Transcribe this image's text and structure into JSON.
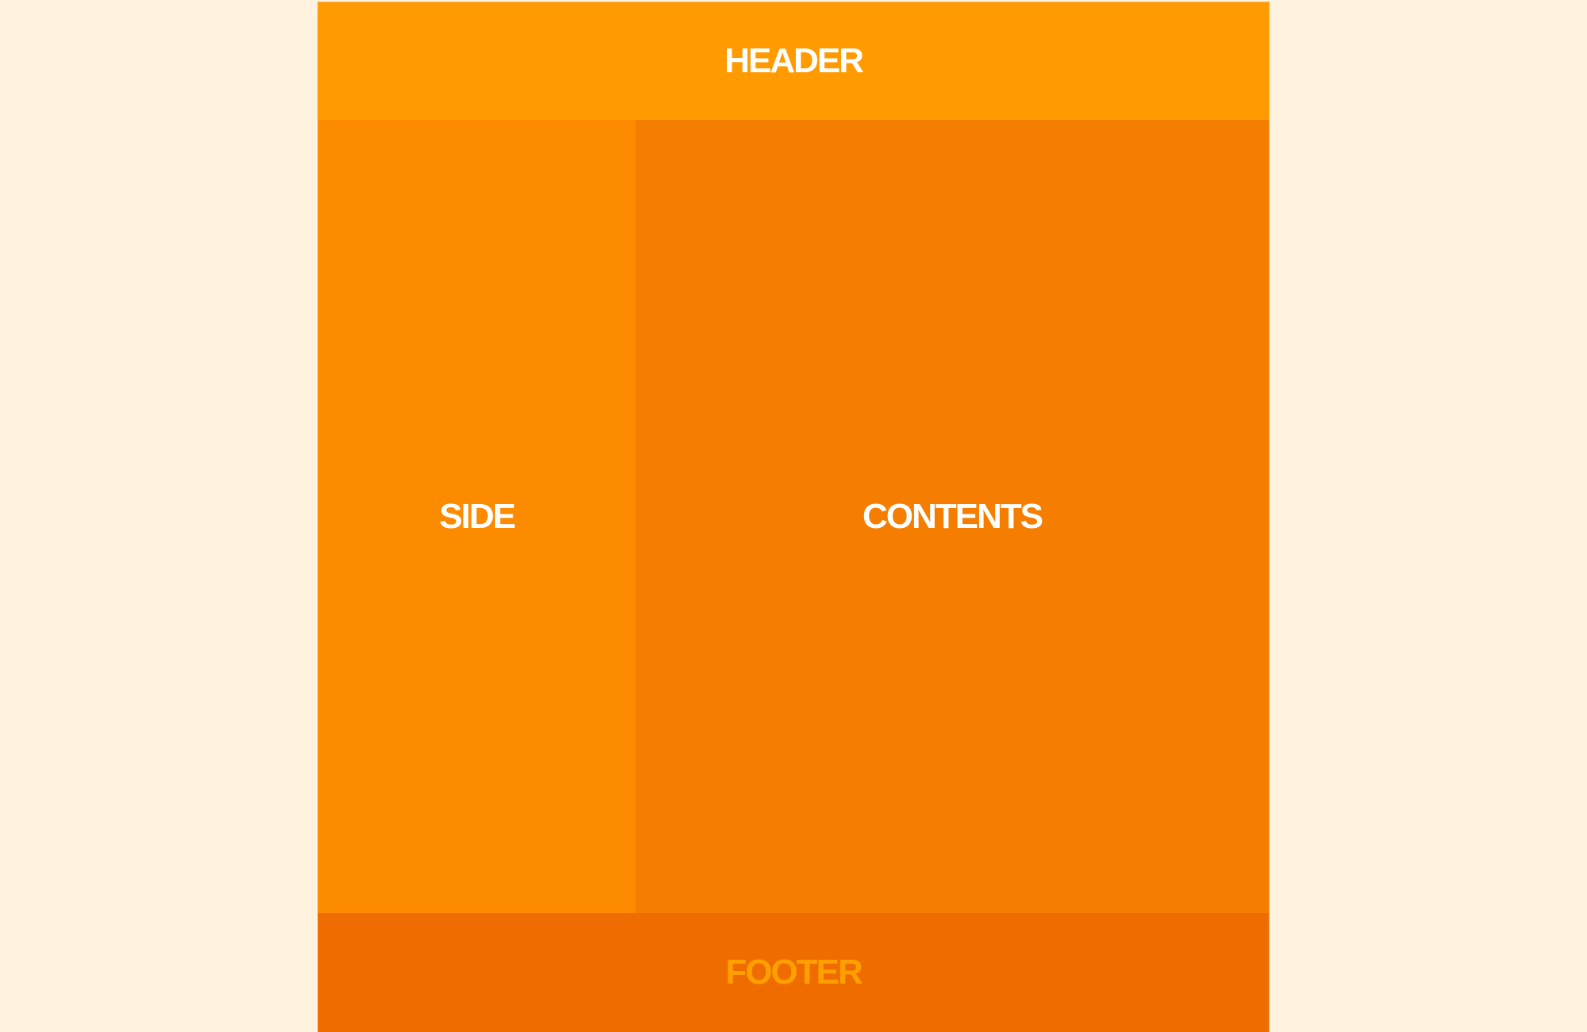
{
  "layout": {
    "header": {
      "label": "HEADER"
    },
    "side": {
      "label": "SIDE"
    },
    "contents": {
      "label": "CONTENTS"
    },
    "footer": {
      "label": "FOOTER"
    }
  },
  "colors": {
    "page_background": "#fff3df",
    "header_background": "#ff9b00",
    "side_background": "#fc8b00",
    "contents_background": "#f57e00",
    "footer_background": "#ef6d00",
    "primary_text": "#ffffff",
    "footer_text": "#ff9f00"
  }
}
